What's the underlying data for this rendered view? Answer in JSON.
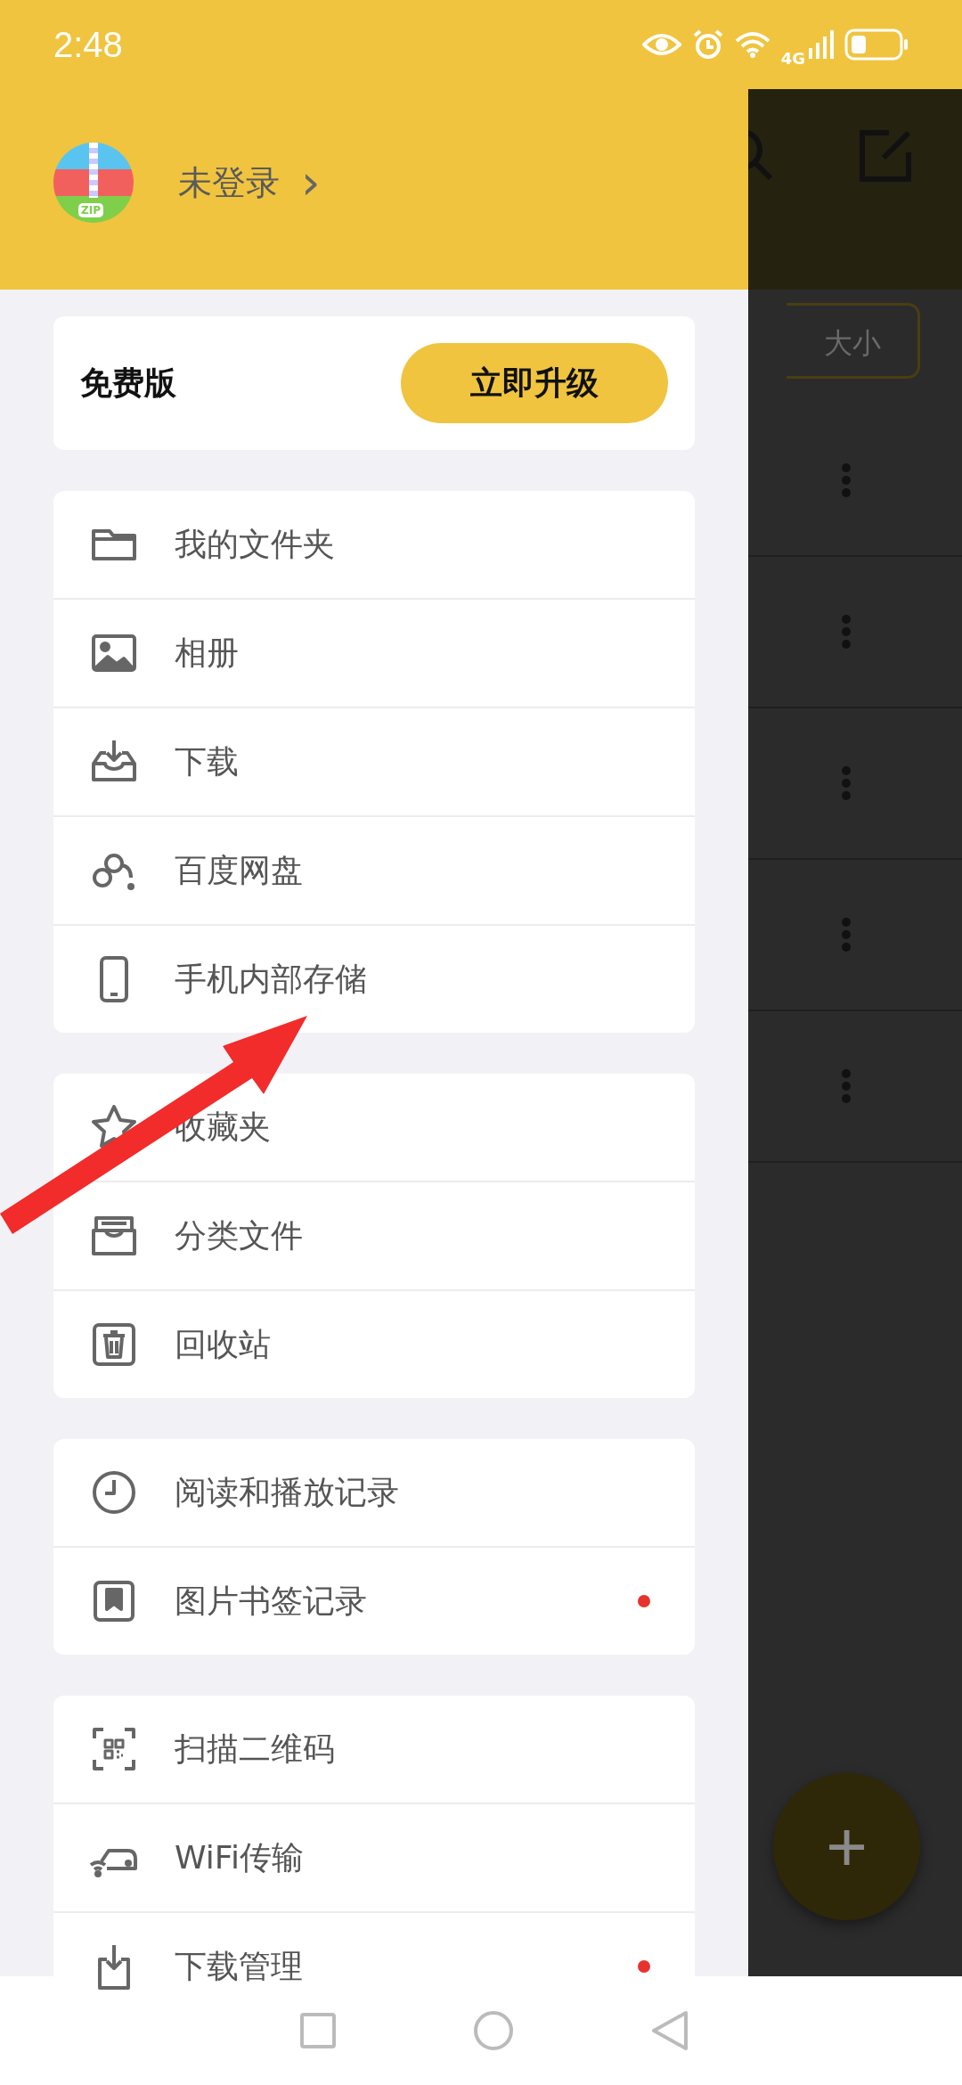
{
  "status_bar": {
    "time": "2:48",
    "network": "4G"
  },
  "account": {
    "logo_text": "ZIP",
    "label": "未登录",
    "chevron": "›"
  },
  "plan": {
    "label": "免费版",
    "upgrade_button": "立即升级"
  },
  "menu_groups": [
    {
      "items": [
        {
          "label": "我的文件夹",
          "unread": false
        },
        {
          "label": "相册",
          "unread": false
        },
        {
          "label": "下载",
          "unread": false
        },
        {
          "label": "百度网盘",
          "unread": false
        },
        {
          "label": "手机内部存储",
          "unread": false
        }
      ]
    },
    {
      "items": [
        {
          "label": "收藏夹",
          "unread": false
        },
        {
          "label": "分类文件",
          "unread": false
        },
        {
          "label": "回收站",
          "unread": false
        }
      ]
    },
    {
      "items": [
        {
          "label": "阅读和播放记录",
          "unread": false
        },
        {
          "label": "图片书签记录",
          "unread": true
        }
      ]
    },
    {
      "items": [
        {
          "label": "扫描二维码",
          "unread": false
        },
        {
          "label": "WiFi传输",
          "unread": false
        },
        {
          "label": "下载管理",
          "unread": true
        }
      ]
    }
  ],
  "background_screen": {
    "sort_chip": "大小",
    "rows": [
      {
        "more_menu": true
      },
      {
        "more_menu": true
      },
      {
        "more_menu": true
      },
      {
        "more_menu": true
      },
      {
        "more_menu": true
      }
    ],
    "fab": "+"
  }
}
